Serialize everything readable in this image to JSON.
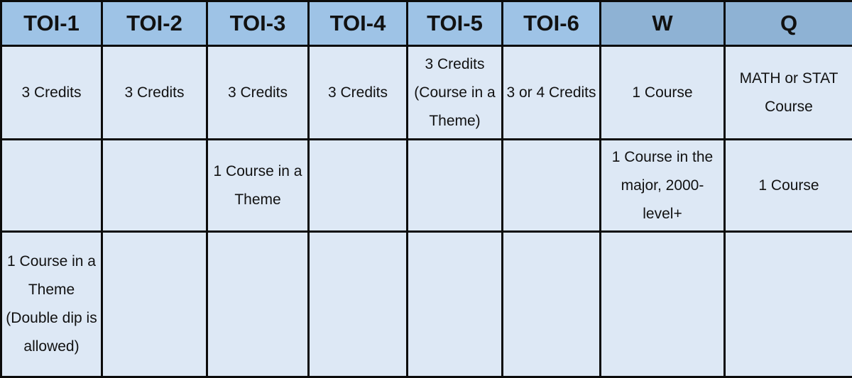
{
  "table": {
    "headers": [
      "TOI-1",
      "TOI-2",
      "TOI-3",
      "TOI-4",
      "TOI-5",
      "TOI-6",
      "W",
      "Q"
    ],
    "rows": [
      [
        "3 Credits",
        "3 Credits",
        "3 Credits",
        "3 Credits",
        "3 Credits\n(Course in a Theme)",
        "3 or 4 Credits",
        "1 Course",
        "MATH or STAT Course"
      ],
      [
        "",
        "",
        "1 Course in a Theme",
        "",
        "",
        "",
        "1 Course in the major, 2000-level+",
        "1 Course"
      ],
      [
        "1 Course in a Theme (Double dip is allowed)",
        "",
        "",
        "",
        "",
        "",
        "",
        ""
      ]
    ]
  },
  "colors": {
    "toi_header": "#9ec3e6",
    "wq_header": "#8eb2d4",
    "cell": "#dde8f5",
    "border": "#0b0b0b"
  }
}
